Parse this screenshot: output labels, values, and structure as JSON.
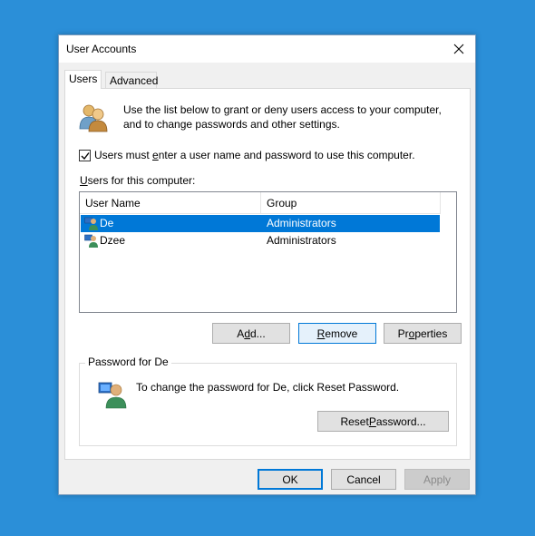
{
  "window": {
    "title": "User Accounts",
    "close_glyph": "✕"
  },
  "tabs": [
    {
      "label": "Users",
      "active": true
    },
    {
      "label": "Advanced",
      "active": false
    }
  ],
  "intro_text": "Use the list below to grant or deny users access to your computer, and to change passwords and other settings.",
  "require_login": {
    "checked": true,
    "label_before": "Users must ",
    "label_accel": "e",
    "label_after": "nter a user name and password to use this computer."
  },
  "users_label": {
    "accel": "U",
    "rest": "sers for this computer:"
  },
  "user_list": {
    "columns": [
      "User Name",
      "Group"
    ],
    "rows": [
      {
        "name": "De",
        "group": "Administrators",
        "selected": true
      },
      {
        "name": "Dzee",
        "group": "Administrators",
        "selected": false
      }
    ]
  },
  "list_buttons": {
    "add": {
      "accel": "d",
      "before": "A",
      "after": "d..."
    },
    "remove": {
      "accel": "R",
      "rest": "emove"
    },
    "properties": {
      "before": "Pr",
      "accel": "o",
      "after": "perties"
    }
  },
  "password_group": {
    "legend": "Password for De",
    "text": "To change the password for De, click Reset Password.",
    "reset_before": "Reset ",
    "reset_accel": "P",
    "reset_after": "assword..."
  },
  "dialog_buttons": {
    "ok": "OK",
    "cancel": "Cancel",
    "apply": "Apply"
  },
  "colors": {
    "desktop": "#2b8fd8",
    "selection": "#0078d7",
    "accent_border": "#0078d7"
  },
  "icons": [
    "close-icon",
    "users-group-icon",
    "checkmark-icon",
    "user-icon",
    "user-key-icon"
  ]
}
